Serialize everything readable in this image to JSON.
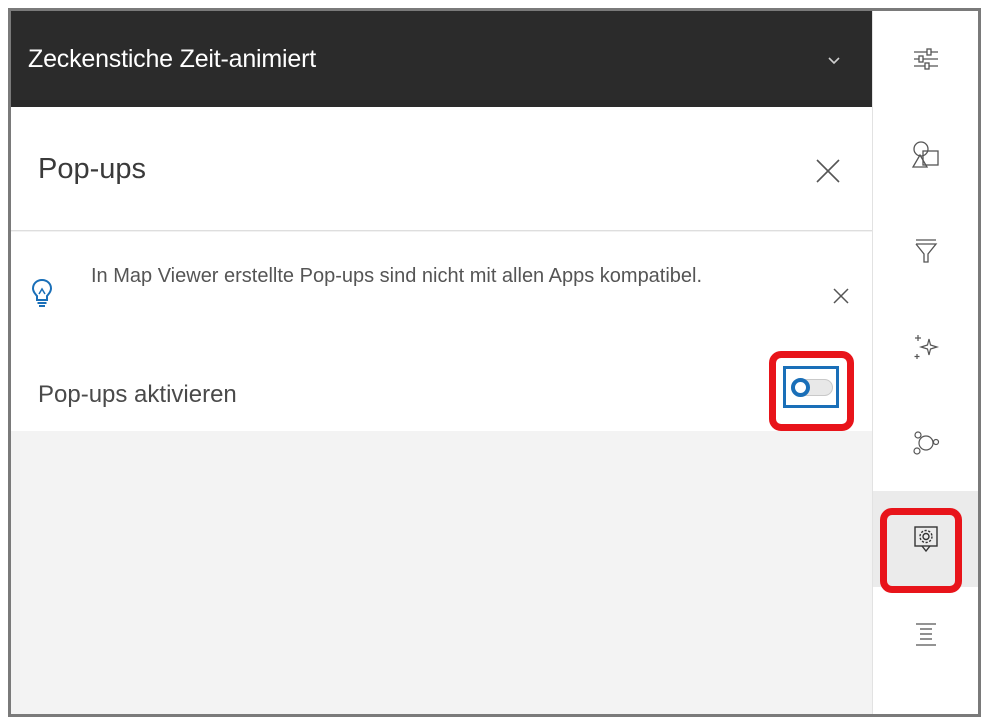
{
  "layer_header": {
    "title": "Zeckenstiche Zeit-animiert",
    "chevron_icon": "chevron-down-icon"
  },
  "popups_panel": {
    "title": "Pop-ups",
    "close_icon": "close-icon"
  },
  "notice": {
    "icon": "lightbulb-icon",
    "text": "In Map Viewer erstellte Pop-ups sind nicht mit allen Apps kompatibel.",
    "close_icon": "close-icon"
  },
  "enable_popups": {
    "label": "Pop-ups aktivieren",
    "enabled": false
  },
  "sidebar": {
    "items": [
      {
        "icon": "properties-sliders-icon",
        "active": false
      },
      {
        "icon": "styles-shapes-icon",
        "active": false
      },
      {
        "icon": "filter-icon",
        "active": false
      },
      {
        "icon": "effects-sparkle-icon",
        "active": false
      },
      {
        "icon": "clustering-icon",
        "active": false
      },
      {
        "icon": "configure-popup-icon",
        "active": true
      },
      {
        "icon": "fields-list-icon",
        "active": false
      }
    ]
  },
  "colors": {
    "header_bg": "#2b2b2b",
    "accent_blue": "#1a6fb8",
    "highlight_red": "#e8141a",
    "panel_bg": "#f3f3f3"
  }
}
